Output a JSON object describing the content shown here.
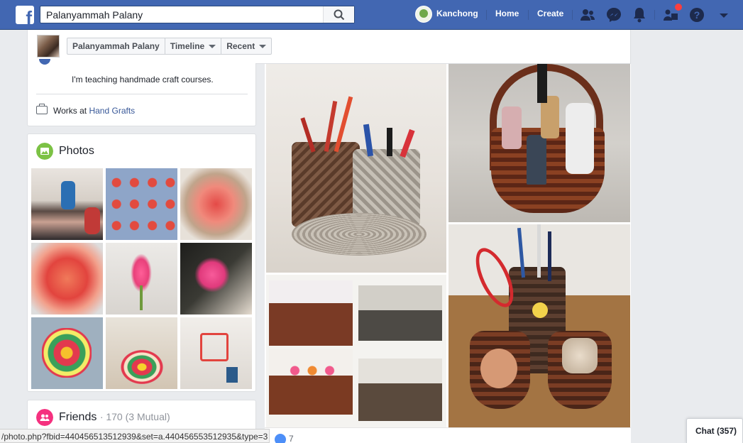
{
  "topbar": {
    "logo": "f",
    "search_value": "Palanyammah Palany",
    "profile_name": "Kanchong",
    "home": "Home",
    "create": "Create"
  },
  "profile_header": {
    "name": "Palanyammah Palany",
    "timeline": "Timeline",
    "recent": "Recent"
  },
  "intro": {
    "bio": "I'm teaching handmade craft courses.",
    "works_prefix": "Works at ",
    "works_link": "Hand Grafts"
  },
  "photos": {
    "title": "Photos",
    "icon_color": "#7cc245"
  },
  "friends": {
    "title": "Friends",
    "count": "· 170 (3 Mutual)",
    "icon_color": "#f5317f"
  },
  "post": {
    "like_count": "7"
  },
  "statusbar": {
    "url": "/photo.php?fbid=440456513512939&set=a.440456553512935&type=3"
  },
  "chat": {
    "label": "Chat (357)"
  },
  "colors": {
    "brand": "#4267b2",
    "link": "#385898",
    "notification": "#fa3e3e"
  }
}
